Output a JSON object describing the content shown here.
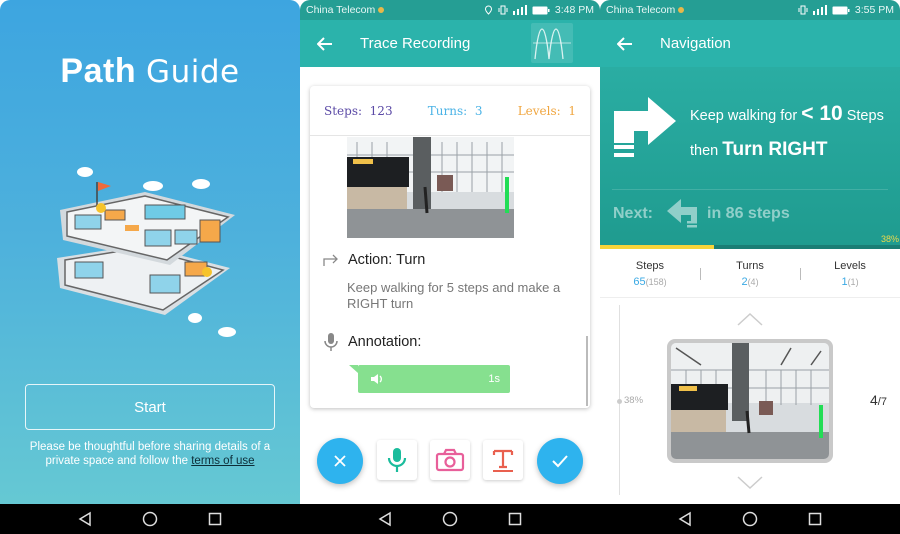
{
  "welcome": {
    "logo_bold": "Path",
    "logo_light": "Guide",
    "start_label": "Start",
    "notice_text": "Please be thoughtful before sharing details of a private space and follow the ",
    "terms_link": "terms of use"
  },
  "recording": {
    "status": {
      "carrier": "China Telecom",
      "time": "3:48 PM"
    },
    "title": "Trace Recording",
    "stats": {
      "steps_label": "Steps:",
      "steps": "123",
      "turns_label": "Turns:",
      "turns": "3",
      "levels_label": "Levels:",
      "levels": "1"
    },
    "action_label": "Action: Turn",
    "action_desc": "Keep walking for 5 steps and make a RIGHT turn",
    "annotation_label": "Annotation:",
    "voice_duration": "1s",
    "colors": {
      "steps": "#5b4aa6",
      "turns": "#4bb3e6",
      "levels": "#f0a640",
      "mic": "#1abc9c",
      "camera": "#e85f9a",
      "text": "#e9604f",
      "fab": "#2eb3ee"
    }
  },
  "navigation": {
    "status": {
      "carrier": "China Telecom",
      "time": "3:55 PM"
    },
    "title": "Navigation",
    "instruction": {
      "pre": "Keep walking for",
      "count": "< 10",
      "unit": "Steps",
      "then": "then",
      "action": "Turn RIGHT"
    },
    "next": {
      "label": "Next:",
      "text": "in 86 steps"
    },
    "progress": {
      "percent": 38,
      "label": "38%"
    },
    "stats": [
      {
        "label": "Steps",
        "value": "65",
        "total": "(158)"
      },
      {
        "label": "Turns",
        "value": "2",
        "total": "(4)"
      },
      {
        "label": "Levels",
        "value": "1",
        "total": "(1)"
      }
    ],
    "timeline_pct": "38%",
    "photo_index": "4",
    "photo_total": "/7"
  }
}
